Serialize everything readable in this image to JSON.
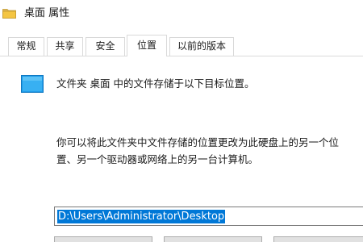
{
  "window": {
    "title": "桌面 属性",
    "title_icon": "folder-icon"
  },
  "tabs": [
    {
      "label": "常规",
      "active": false
    },
    {
      "label": "共享",
      "active": false
    },
    {
      "label": "安全",
      "active": false
    },
    {
      "label": "位置",
      "active": true
    },
    {
      "label": "以前的版本",
      "active": false
    }
  ],
  "content": {
    "location_text": "文件夹 桌面 中的文件存储于以下目标位置。",
    "description_line1": "你可以将此文件夹中文件存储的位置更改为此硬盘上的另一个位",
    "description_line2": "置、另一个驱动器或网络上的另一台计算机。",
    "path_value": "D:\\Users\\Administrator\\Desktop",
    "folder_icon": "desktop-folder-icon"
  },
  "colors": {
    "selection": "#0078d7",
    "folder_blue": "#1e9be8",
    "folder_yellow": "#f4c542"
  }
}
